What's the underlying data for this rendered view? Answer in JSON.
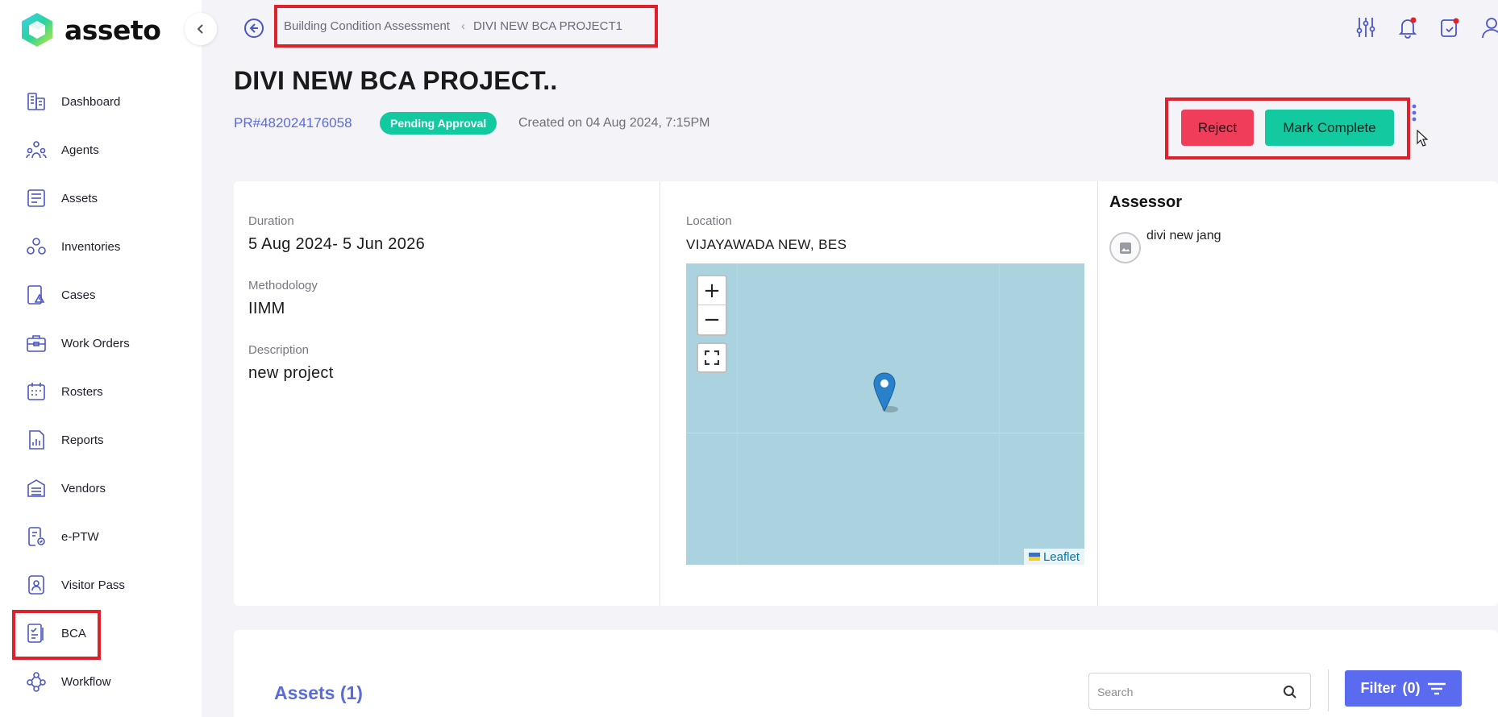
{
  "app": {
    "name": "asseto"
  },
  "sidebar": {
    "items": [
      {
        "label": "Dashboard",
        "icon": "dashboard-icon"
      },
      {
        "label": "Agents",
        "icon": "agents-icon"
      },
      {
        "label": "Assets",
        "icon": "assets-icon"
      },
      {
        "label": "Inventories",
        "icon": "inventories-icon"
      },
      {
        "label": "Cases",
        "icon": "cases-icon"
      },
      {
        "label": "Work Orders",
        "icon": "work-orders-icon"
      },
      {
        "label": "Rosters",
        "icon": "rosters-icon"
      },
      {
        "label": "Reports",
        "icon": "reports-icon"
      },
      {
        "label": "Vendors",
        "icon": "vendors-icon"
      },
      {
        "label": "e-PTW",
        "icon": "eptw-icon"
      },
      {
        "label": "Visitor Pass",
        "icon": "visitor-pass-icon"
      },
      {
        "label": "BCA",
        "icon": "bca-icon",
        "highlighted": true
      },
      {
        "label": "Workflow",
        "icon": "workflow-icon"
      }
    ]
  },
  "breadcrumb": {
    "parent": "Building Condition Assessment",
    "current": "DIVI NEW BCA PROJECT1"
  },
  "header": {
    "title": "DIVI NEW BCA PROJECT..",
    "project_id": "PR#482024176058",
    "status": "Pending Approval",
    "created": "Created on 04 Aug 2024, 7:15PM"
  },
  "actions": {
    "reject_label": "Reject",
    "complete_label": "Mark Complete"
  },
  "details": {
    "duration_label": "Duration",
    "duration": "5 Aug 2024- 5 Jun 2026",
    "methodology_label": "Methodology",
    "methodology": "IIMM",
    "description_label": "Description",
    "description": "new project",
    "location_label": "Location",
    "location": "VIJAYAWADA NEW, BES"
  },
  "map": {
    "zoom_in": "+",
    "zoom_out": "−",
    "attribution": "Leaflet"
  },
  "assessor": {
    "title": "Assessor",
    "name": "divi new jang"
  },
  "assets": {
    "title": "Assets (1)",
    "search_placeholder": "Search",
    "filter_label": "Filter",
    "filter_count": "(0)"
  },
  "colors": {
    "accent": "#5a6bf0",
    "status_green": "#13c9a0",
    "reject_red": "#ef3d5a",
    "icon_blue": "#4a56c8",
    "highlight_red": "#e0202a"
  }
}
